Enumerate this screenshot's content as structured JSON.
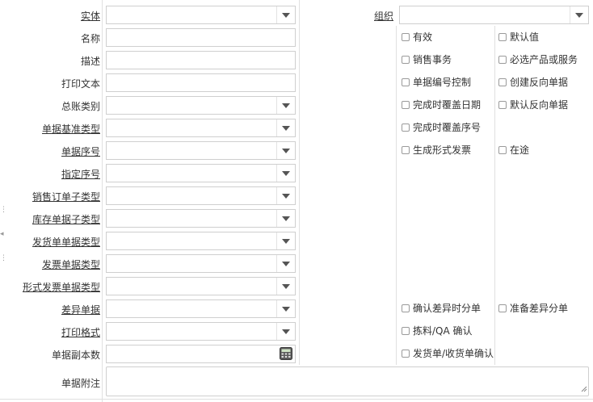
{
  "left_fields": [
    {
      "label": "实体",
      "type": "combo",
      "link": true
    },
    {
      "label": "名称",
      "type": "text",
      "link": false
    },
    {
      "label": "描述",
      "type": "text",
      "link": false
    },
    {
      "label": "打印文本",
      "type": "text",
      "link": false
    },
    {
      "label": "总账类别",
      "type": "combo",
      "link": false
    },
    {
      "label": "单据基准类型",
      "type": "combo",
      "link": true
    },
    {
      "label": "单据序号",
      "type": "combo",
      "link": true
    },
    {
      "label": "指定序号",
      "type": "combo",
      "link": true
    },
    {
      "label": "销售订单子类型",
      "type": "combo",
      "link": true
    },
    {
      "label": "库存单据子类型",
      "type": "combo",
      "link": true
    },
    {
      "label": "发货单单据类型",
      "type": "combo",
      "link": true
    },
    {
      "label": "发票单据类型",
      "type": "combo",
      "link": true
    },
    {
      "label": "形式发票单据类型",
      "type": "combo",
      "link": true
    },
    {
      "label": "差异单据",
      "type": "combo",
      "link": true
    },
    {
      "label": "打印格式",
      "type": "combo",
      "link": true
    },
    {
      "label": "单据副本数",
      "type": "number",
      "link": false
    }
  ],
  "note_label": "单据附注",
  "org_label": "组织",
  "checkboxes_col1": [
    "有效",
    "销售事务",
    "单据编号控制",
    "完成时覆盖日期",
    "完成时覆盖序号",
    "生成形式发票"
  ],
  "checkboxes_col2": [
    "默认值",
    "必选产品或服务",
    "创建反向单据",
    "默认反向单据",
    "在途"
  ],
  "checkboxes_bottom_col1": [
    "确认差异时分单",
    "拣料/QA 确认",
    "发货单/收货单确认"
  ],
  "checkboxes_bottom_col2": [
    "准备差异分单"
  ]
}
